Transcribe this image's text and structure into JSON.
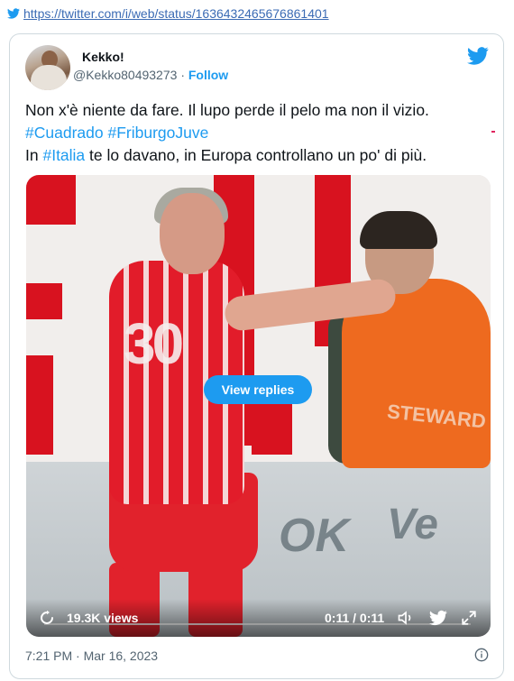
{
  "top_link": {
    "url_text": "https://twitter.com/i/web/status/1636432465676861401"
  },
  "author": {
    "name": "Kekko!",
    "handle": "@Kekko80493273",
    "separator": "·",
    "follow_label": "Follow"
  },
  "tweet": {
    "line1": "Non x'è niente da fare. Il lupo perde il pelo ma non il vizio.",
    "hashtag1": "#Cuadrado",
    "hashtag2": "#FriburgoJuve",
    "line3_prefix": "In ",
    "hashtag3": "#Italia",
    "line3_suffix": " te lo davano, in Europa controllano un po' di più."
  },
  "video": {
    "view_replies_label": "View replies",
    "views": "19.3K views",
    "time": "0:11 / 0:11",
    "jersey_number": "30",
    "steward_text": "STEWARD",
    "ad_text": "OK"
  },
  "footer": {
    "timestamp": "7:21 PM · Mar 16, 2023"
  },
  "colors": {
    "accent": "#1d9bf0",
    "text": "#0f1419",
    "muted": "#536471",
    "border": "#cfd9de"
  },
  "icons": [
    "twitter-bird-icon",
    "replay-icon",
    "volume-icon",
    "fullscreen-icon",
    "info-icon"
  ]
}
